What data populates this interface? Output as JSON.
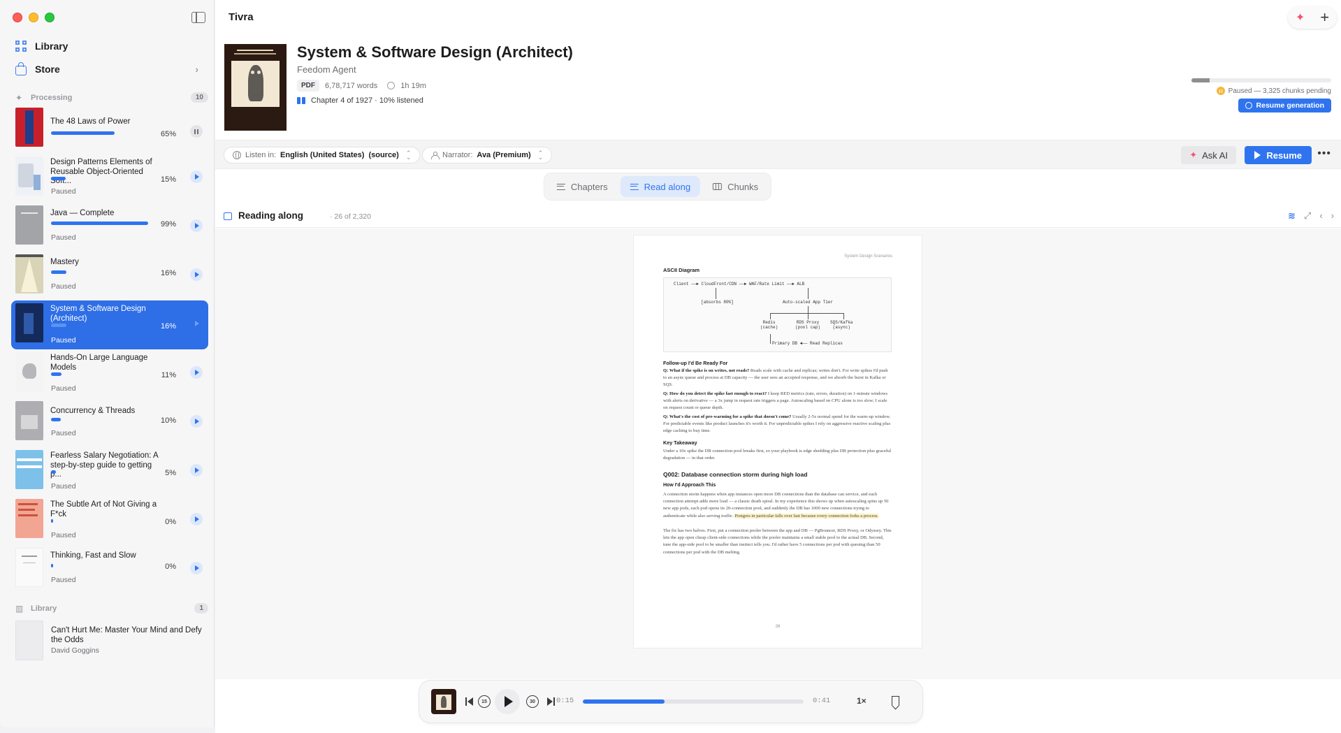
{
  "app": {
    "title": "Tivra"
  },
  "sidebar": {
    "nav": [
      {
        "label": "Library",
        "icon": "grid-icon"
      },
      {
        "label": "Store",
        "icon": "bag-icon"
      }
    ],
    "processing": {
      "label": "Processing",
      "count": "10"
    },
    "books": [
      {
        "title": "The 48 Laws of Power",
        "pct": "65%",
        "progress": 0.65,
        "status": "",
        "control": "pause"
      },
      {
        "title": "Design Patterns Elements of Reusable Object-Oriented Soft...",
        "pct": "15%",
        "progress": 0.15,
        "status": "Paused",
        "control": "play"
      },
      {
        "title": "Java — Complete",
        "pct": "99%",
        "progress": 0.99,
        "status": "Paused",
        "control": "play"
      },
      {
        "title": "Mastery",
        "pct": "16%",
        "progress": 0.16,
        "status": "Paused",
        "control": "play"
      },
      {
        "title": "System & Software Design (Architect)",
        "pct": "16%",
        "progress": 0.16,
        "status": "Paused",
        "control": "play",
        "active": true
      },
      {
        "title": "Hands-On Large Language Models",
        "pct": "11%",
        "progress": 0.11,
        "status": "Paused",
        "control": "play"
      },
      {
        "title": "Concurrency & Threads",
        "pct": "10%",
        "progress": 0.1,
        "status": "Paused",
        "control": "play"
      },
      {
        "title": "Fearless Salary Negotiation: A step-by-step guide to getting p...",
        "pct": "5%",
        "progress": 0.05,
        "status": "Paused",
        "control": "play"
      },
      {
        "title": "The Subtle Art of Not Giving a F*ck",
        "pct": "0%",
        "progress": 0.02,
        "status": "Paused",
        "control": "play"
      },
      {
        "title": "Thinking, Fast and Slow",
        "pct": "0%",
        "progress": 0.02,
        "status": "Paused",
        "control": "play"
      }
    ],
    "library": {
      "label": "Library",
      "count": "1"
    },
    "library_book": {
      "title": "Can't Hurt Me: Master Your Mind and Defy the Odds",
      "author": "David Goggins"
    }
  },
  "book": {
    "title": "System & Software Design (Architect)",
    "author": "Feedom Agent",
    "format": "PDF",
    "words": "6,78,717 words",
    "duration": "1h 19m",
    "chapter": "Chapter 4 of 1927 · 10% listened"
  },
  "generation": {
    "progress": 0.13,
    "status": "Paused — 3,325 chunks pending",
    "resume_label": "Resume generation"
  },
  "toolbar": {
    "listen_label": "Listen in:",
    "listen_value": "English (United States)",
    "listen_suffix": "(source)",
    "narrator_label": "Narrator:",
    "narrator_value": "Ava (Premium)",
    "ask_ai": "Ask AI",
    "resume": "Resume"
  },
  "tabs": [
    {
      "label": "Chapters",
      "active": false
    },
    {
      "label": "Read along",
      "active": true
    },
    {
      "label": "Chunks",
      "active": false
    }
  ],
  "reading": {
    "title": "Reading along",
    "count": "· 26 of 2,320"
  },
  "page": {
    "header": "System Design Scenarios",
    "diagram_title": "ASCII Diagram",
    "diagram": {
      "row1": "Client ──► CloudFront/CDN ──► WAF/Rate Limit ──► ALB",
      "absorbs": "[absorbs 80%]",
      "autoscaled": "Auto-scaled App Tier",
      "redis": "Redis\n(cache)",
      "rds": "RDS Proxy\n(pool cap)",
      "sqs": "SQS/Kafka\n(async)",
      "bottom": "Primary DB ◄── Read Replicas"
    },
    "followup_title": "Follow-up I'd Be Ready For",
    "q1": {
      "q": "Q: What if the spike is on writes, not reads?",
      "a": " Reads scale with cache and replicas; writes don't. For write spikes I'd push to an async queue and process at DB capacity — the user sees an accepted response, and we absorb the burst in Kafka or SQS."
    },
    "q2": {
      "q": "Q: How do you detect the spike fast enough to react?",
      "a": " I keep RED metrics (rate, errors, duration) on 1-minute windows with alerts on derivative — a 3x jump in request rate triggers a page. Autoscaling based on CPU alone is too slow; I scale on request count or queue depth."
    },
    "q3": {
      "q": "Q: What's the cost of pre-warming for a spike that doesn't come?",
      "a": " Usually 2-5x normal spend for the warm-up window. For predictable events like product launches it's worth it. For unpredictable spikes I rely on aggressive reactive scaling plus edge caching to buy time."
    },
    "takeaway_title": "Key Takeaway",
    "takeaway": "Under a 10x spike the DB connection pool breaks first, so your playbook is edge shedding plus DB protection plus graceful degradation — in that order.",
    "q002_title": "Q002: Database connection storm during high load",
    "approach_title": "How I'd Approach This",
    "approach_p1": "A connection storm happens when app instances open more DB connections than the database can service, and each connection attempt adds more load — a classic death spiral. In my experience this shows up when autoscaling spins up 50 new app pods, each pod opens its 20-connection pool, and suddenly the DB has 1000 new connections trying to authenticate while also serving traffic. ",
    "approach_highlight": "Postgres in particular falls over fast because every connection forks a process.",
    "approach_p2": "The fix has two halves. First, put a connection pooler between the app and DB — PgBouncer, RDS Proxy, or Odyssey. This lets the app open cheap client-side connections while the pooler maintains a small stable pool to the actual DB. Second, tune the app-side pool to be smaller than instinct tells you. I'd rather have 5 connections per pod with queuing than 50 connections per pod with the DB melting.",
    "page_number": "26"
  },
  "player": {
    "elapsed": "0:15",
    "remaining": "0:41",
    "progress": 0.37,
    "back_seconds": "15",
    "fwd_seconds": "30",
    "speed": "1×"
  },
  "colors": {
    "accent": "#2f74ee",
    "active_row": "#2e6ee6",
    "warning": "#f5b73b"
  }
}
